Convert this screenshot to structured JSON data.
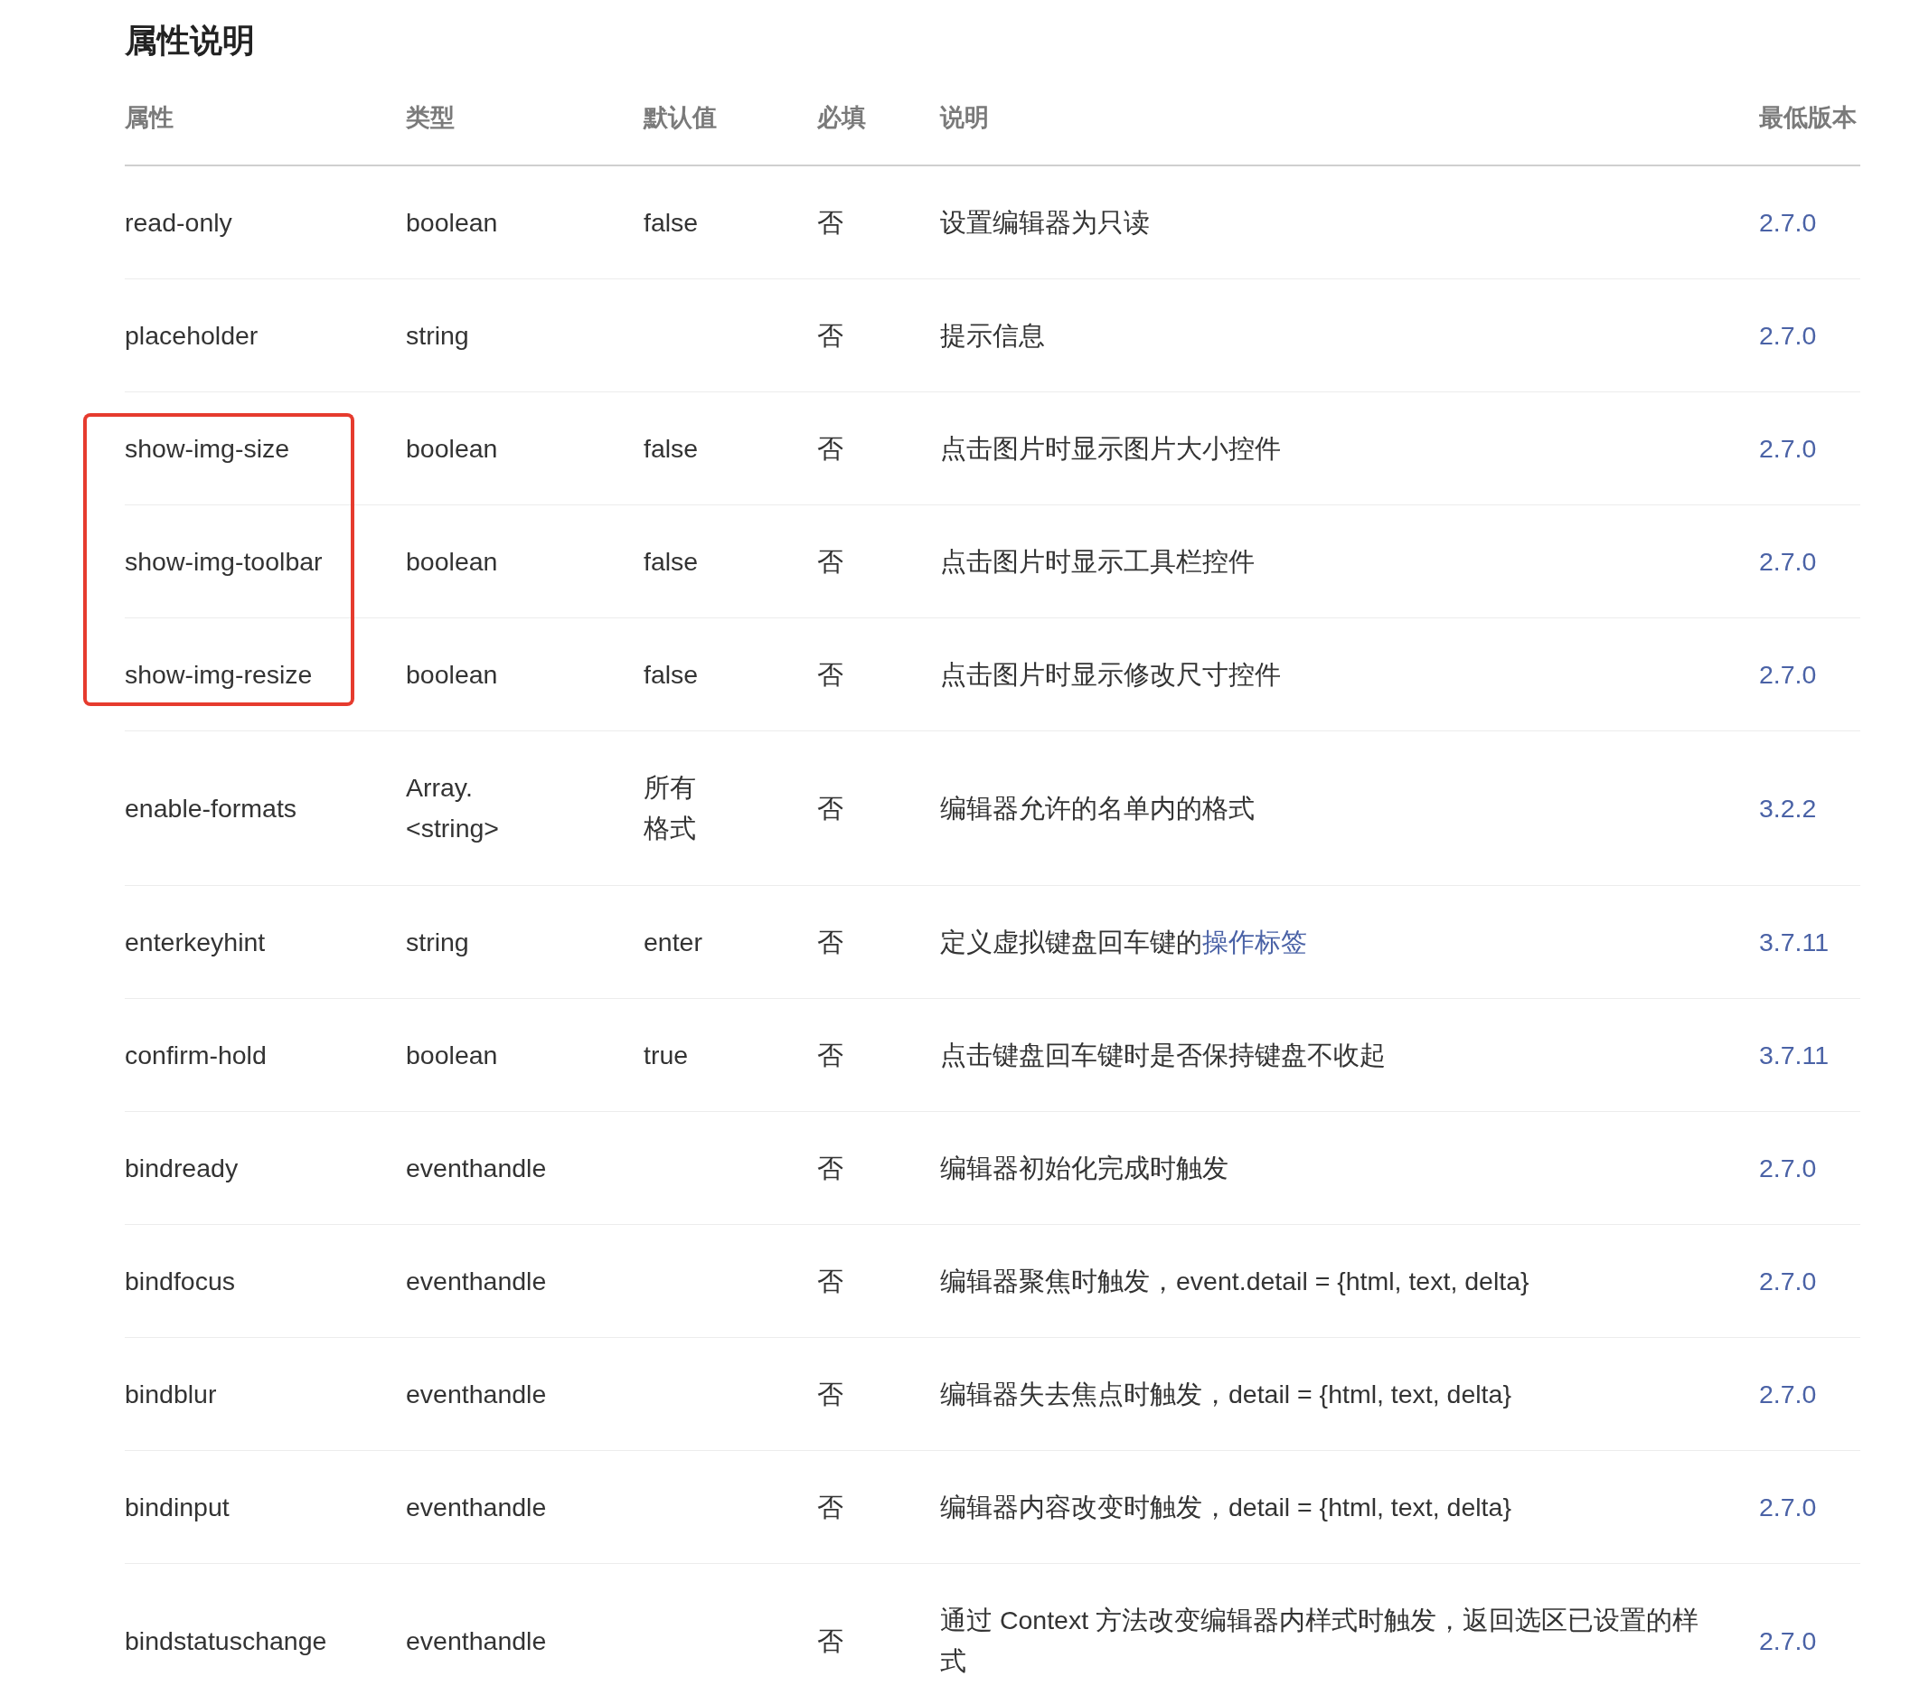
{
  "title": "属性说明",
  "columns": [
    "属性",
    "类型",
    "默认值",
    "必填",
    "说明",
    "最低版本"
  ],
  "rows": [
    {
      "name": "read-only",
      "type": "boolean",
      "default": "false",
      "required": "否",
      "description": "设置编辑器为只读",
      "version": "2.7.0",
      "highlighted": false
    },
    {
      "name": "placeholder",
      "type": "string",
      "required": "否",
      "description": "提示信息",
      "version": "2.7.0",
      "highlighted": false
    },
    {
      "name": "show-img-size",
      "type": "boolean",
      "default": "false",
      "required": "否",
      "description": "点击图片时显示图片大小控件",
      "version": "2.7.0",
      "highlighted": true
    },
    {
      "name": "show-img-toolbar",
      "type": "boolean",
      "default": "false",
      "required": "否",
      "description": "点击图片时显示工具栏控件",
      "version": "2.7.0",
      "highlighted": true
    },
    {
      "name": "show-img-resize",
      "type": "boolean",
      "default": "false",
      "required": "否",
      "description": "点击图片时显示修改尺寸控件",
      "version": "2.7.0",
      "highlighted": true
    },
    {
      "name": "enable-formats",
      "type": "Array.<string>",
      "default": "所有格式",
      "required": "否",
      "description": "编辑器允许的名单内的格式",
      "version": "3.2.2",
      "highlighted": false
    },
    {
      "name": "enterkeyhint",
      "type": "string",
      "default": "enter",
      "required": "否",
      "description": "定义虚拟键盘回车键的",
      "link": "操作标签",
      "version": "3.7.11",
      "highlighted": false
    },
    {
      "name": "confirm-hold",
      "type": "boolean",
      "default": "true",
      "required": "否",
      "description": "点击键盘回车键时是否保持键盘不收起",
      "version": "3.7.11",
      "highlighted": false
    },
    {
      "name": "bindready",
      "type": "eventhandle",
      "required": "否",
      "description": "编辑器初始化完成时触发",
      "version": "2.7.0",
      "highlighted": false
    },
    {
      "name": "bindfocus",
      "type": "eventhandle",
      "required": "否",
      "description": "编辑器聚焦时触发，event.detail = {html, text, delta}",
      "version": "2.7.0",
      "highlighted": false
    },
    {
      "name": "bindblur",
      "type": "eventhandle",
      "required": "否",
      "description": "编辑器失去焦点时触发，detail = {html, text, delta}",
      "version": "2.7.0",
      "highlighted": false
    },
    {
      "name": "bindinput",
      "type": "eventhandle",
      "required": "否",
      "description": "编辑器内容改变时触发，detail = {html, text, delta}",
      "version": "2.7.0",
      "highlighted": false
    },
    {
      "name": "bindstatuschange",
      "type": "eventhandle",
      "required": "否",
      "description": "通过 Context 方法改变编辑器内样式时触发，返回选区已设置的样式",
      "version": "2.7.0",
      "highlighted": false
    }
  ]
}
